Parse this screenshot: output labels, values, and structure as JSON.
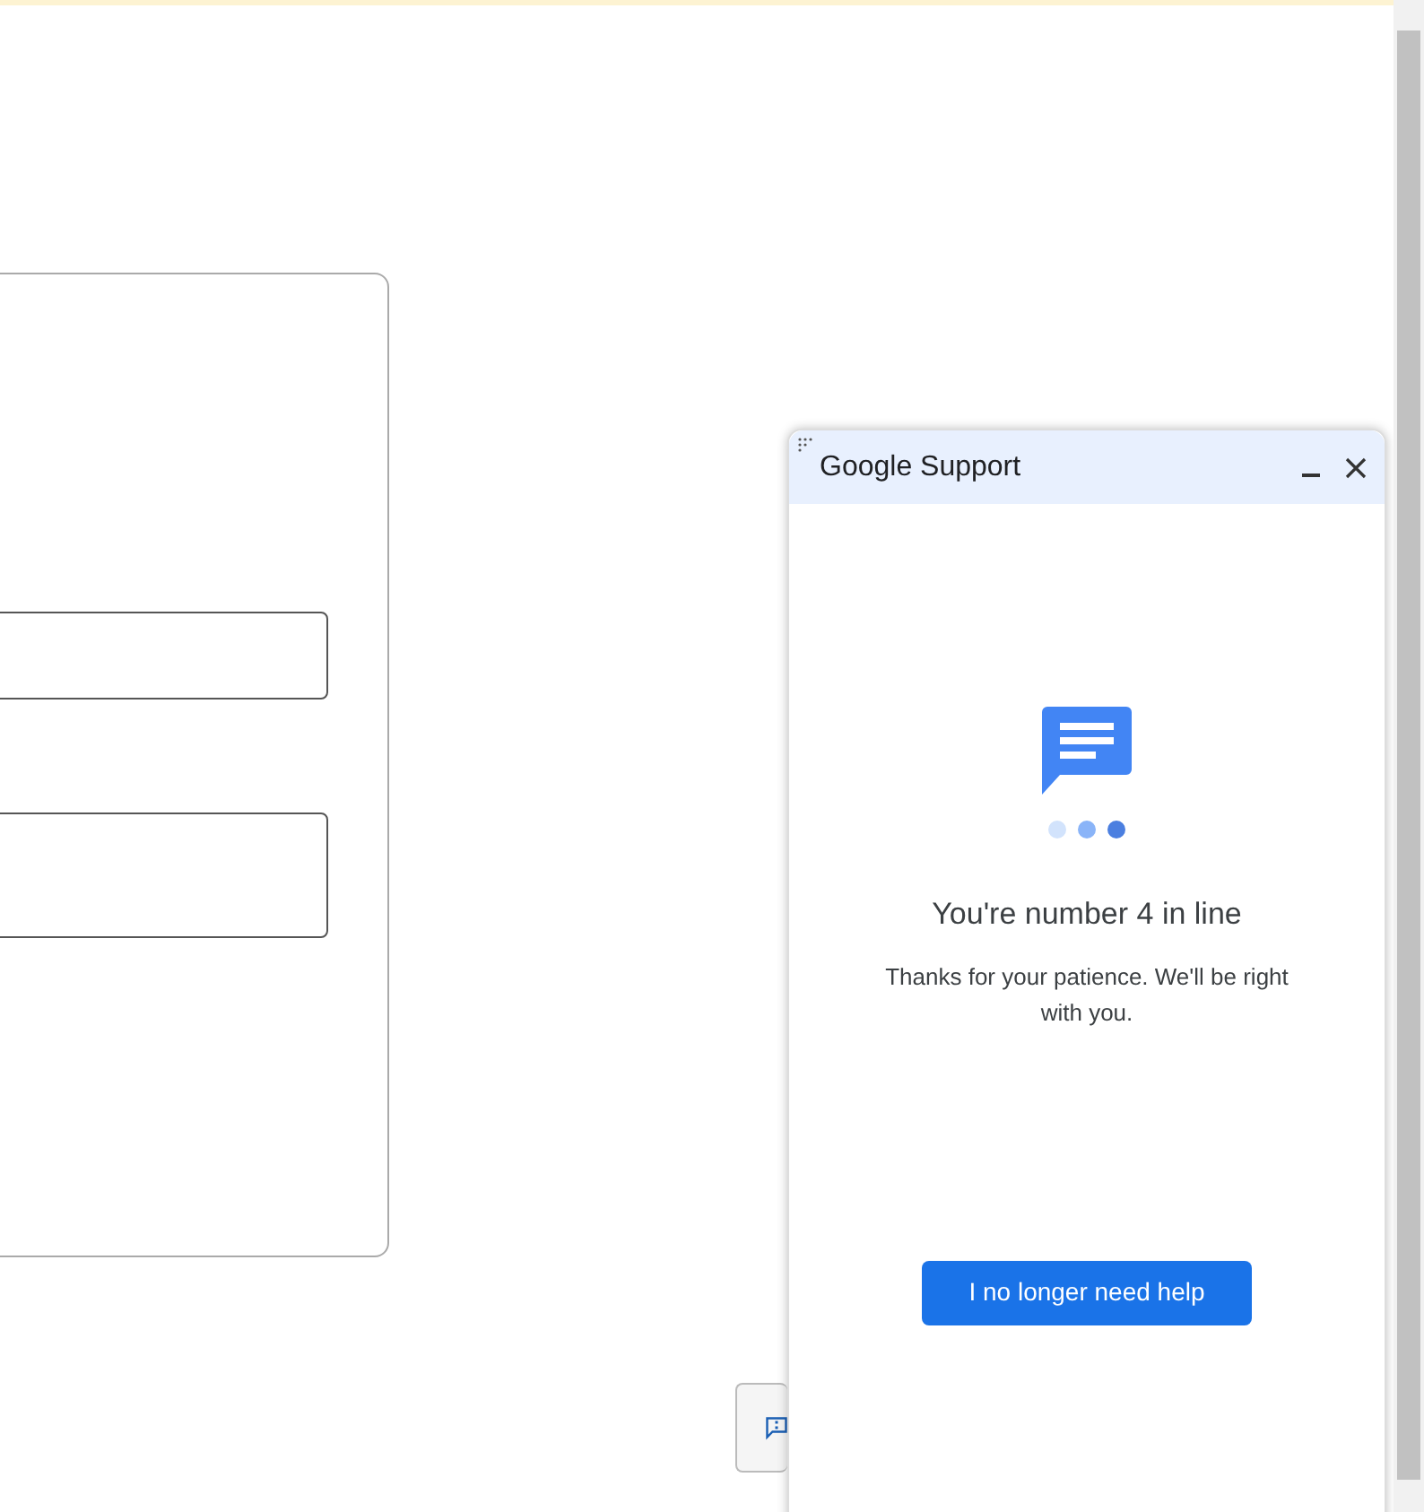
{
  "chat_panel": {
    "title": "Google Support",
    "queue_message": "You're number 4 in line",
    "subtext": "Thanks for your patience. We'll be right with you.",
    "button": "I no longer need help"
  }
}
